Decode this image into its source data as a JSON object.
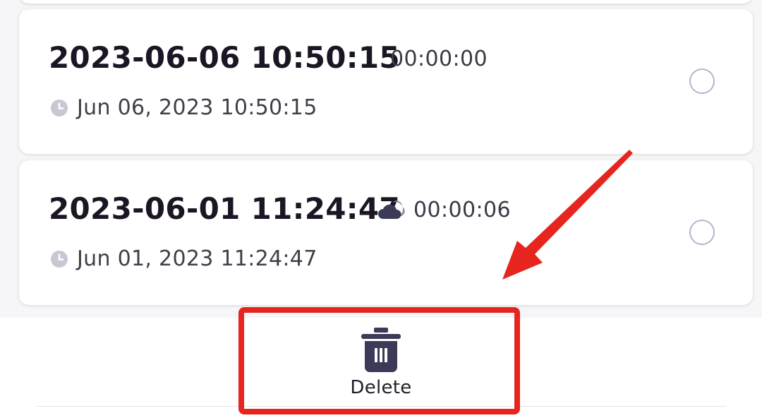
{
  "recordings": [
    {
      "title": "2023-06-06 10:50:15",
      "duration": "00:00:00",
      "cloud_synced": false,
      "date_label": "Jun 06, 2023 10:50:15",
      "selected": false
    },
    {
      "title": "2023-06-01 11:24:47",
      "duration": "00:00:06",
      "cloud_synced": true,
      "date_label": "Jun 01, 2023 11:24:47",
      "selected": false
    }
  ],
  "toolbar": {
    "delete_label": "Delete",
    "delete_icon": "trash-icon"
  },
  "annotation": {
    "color": "#e6251f"
  },
  "icons": {
    "clock": "clock-icon",
    "cloud": "cloud-icon"
  },
  "colors": {
    "icon_dark": "#3b3a58",
    "radio_border": "#b7b3cc",
    "clock_gray": "#c9c7d3"
  }
}
